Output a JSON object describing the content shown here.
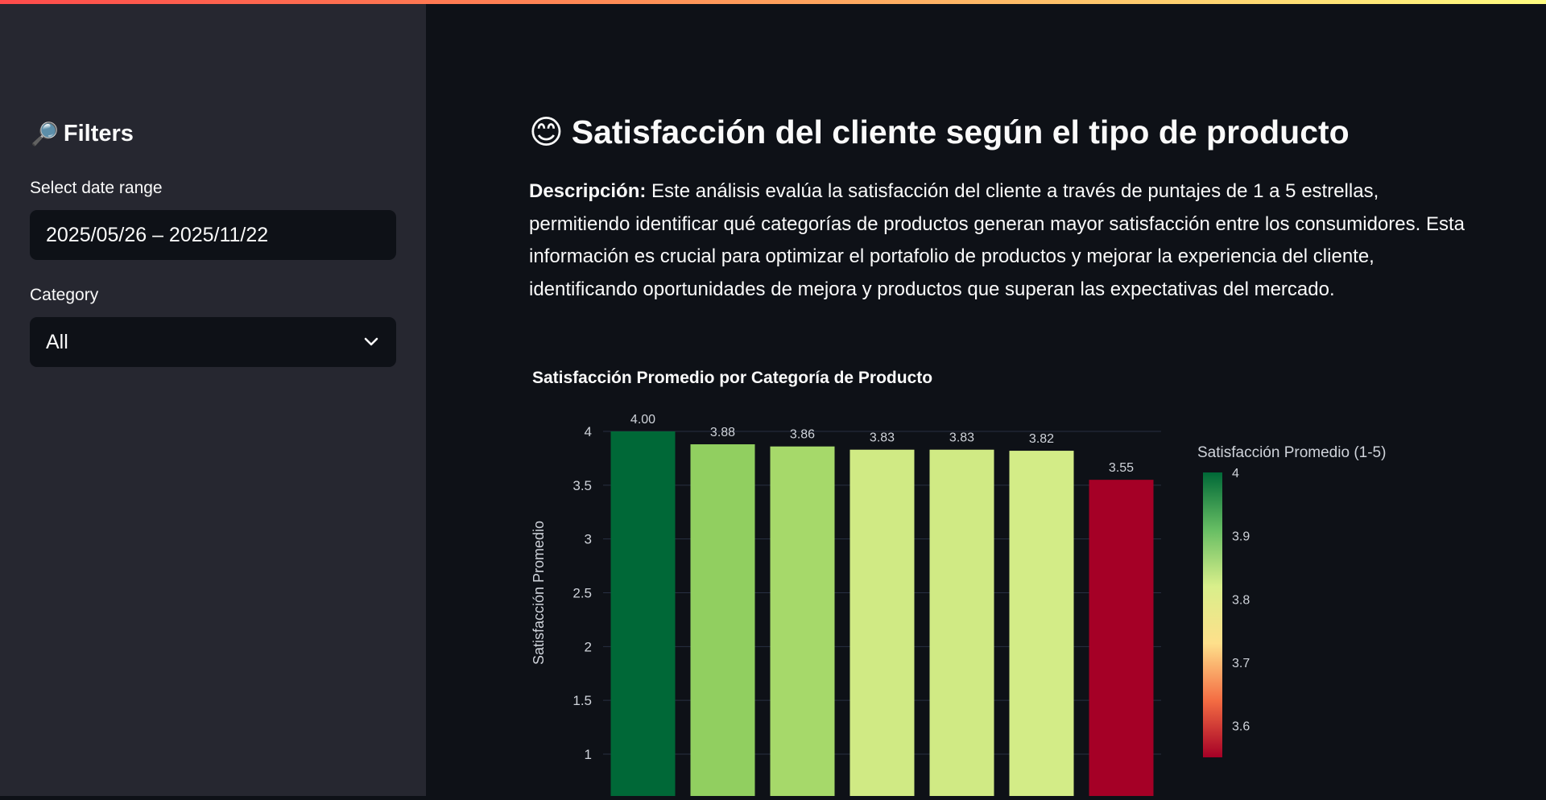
{
  "sidebar": {
    "title_icon": "🔎",
    "title": "Filters",
    "date_label": "Select date range",
    "date_value": "2025/05/26 – 2025/11/22",
    "category_label": "Category",
    "category_value": "All"
  },
  "main": {
    "title_emoji": "😊",
    "title": "Satisfacción del cliente según el tipo de producto",
    "description_bold": "Descripción:",
    "description_text": "Este análisis evalúa la satisfacción del cliente a través de puntajes de 1 a 5 estrellas, permitiendo identificar qué categorías de productos generan mayor satisfacción entre los consumidores. Esta información es crucial para optimizar el portafolio de productos y mejorar la experiencia del cliente, identificando oportunidades de mejora y productos que superan las expectativas del mercado."
  },
  "colors": {
    "accent_gradient_start": "#ff4b4b",
    "accent_gradient_end": "#fffd80",
    "sidebar_bg": "#262730",
    "main_bg": "#0e1117"
  },
  "chart_data": {
    "type": "bar",
    "title": "Satisfacción Promedio por Categoría de Producto",
    "ylabel": "Satisfacción Promedio",
    "values": [
      4.0,
      3.88,
      3.86,
      3.83,
      3.83,
      3.82,
      3.55
    ],
    "data_labels": [
      "4.00",
      "3.88",
      "3.86",
      "3.83",
      "3.83",
      "3.82",
      "3.55"
    ],
    "bar_colors": [
      "#006837",
      "#91cf60",
      "#a6d96a",
      "#d0ea84",
      "#d0ea84",
      "#d3ec87",
      "#a50026"
    ],
    "y_ticks": [
      "1",
      "1.5",
      "2",
      "2.5",
      "3",
      "3.5",
      "4"
    ],
    "ylim": [
      0.6,
      4.05
    ],
    "grid": true,
    "colorbar": {
      "title": "Satisfacción Promedio (1-5)",
      "ticks": [
        "4",
        "3.9",
        "3.8",
        "3.7",
        "3.6"
      ],
      "range": [
        3.55,
        4.0
      ],
      "colorscale": [
        "#a50026",
        "#f46d43",
        "#fee08b",
        "#d9ef8b",
        "#66bd63",
        "#006837"
      ]
    }
  }
}
